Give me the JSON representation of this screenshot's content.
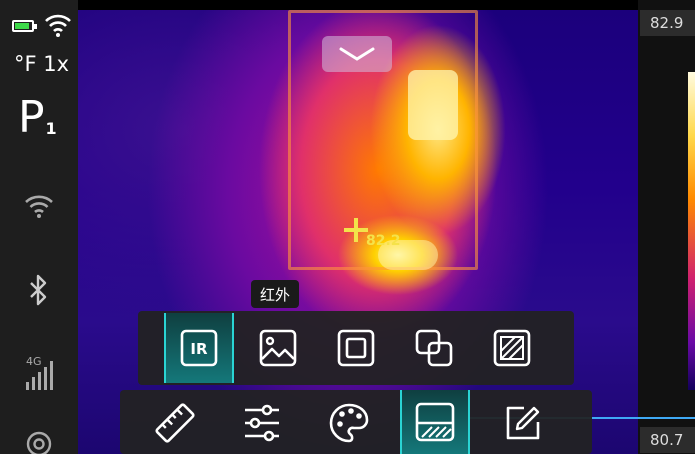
{
  "status": {
    "temp_unit": "°F",
    "zoom": "1x",
    "profile": "P",
    "profile_index": "1",
    "signal_label": "4G",
    "battery_color": "#3ed94a"
  },
  "thermal": {
    "crosshair_temp": "82.2",
    "tooltip": "红外",
    "accent": "#2ad4d4"
  },
  "scale": {
    "max": "82.9",
    "min": "80.7"
  },
  "imaging_modes": [
    {
      "icon": "ir-mode-icon",
      "label": "IR",
      "active": true
    },
    {
      "icon": "visible-image-icon",
      "active": false
    },
    {
      "icon": "frame-mode-icon",
      "active": false
    },
    {
      "icon": "fusion-mode-icon",
      "active": false
    },
    {
      "icon": "blend-mode-icon",
      "active": false
    }
  ],
  "toolbar": [
    {
      "icon": "measure-tool-icon",
      "active": false
    },
    {
      "icon": "adjust-sliders-icon",
      "active": false
    },
    {
      "icon": "palette-icon",
      "active": false
    },
    {
      "icon": "level-span-icon",
      "active": true
    },
    {
      "icon": "annotate-icon",
      "active": false
    }
  ]
}
